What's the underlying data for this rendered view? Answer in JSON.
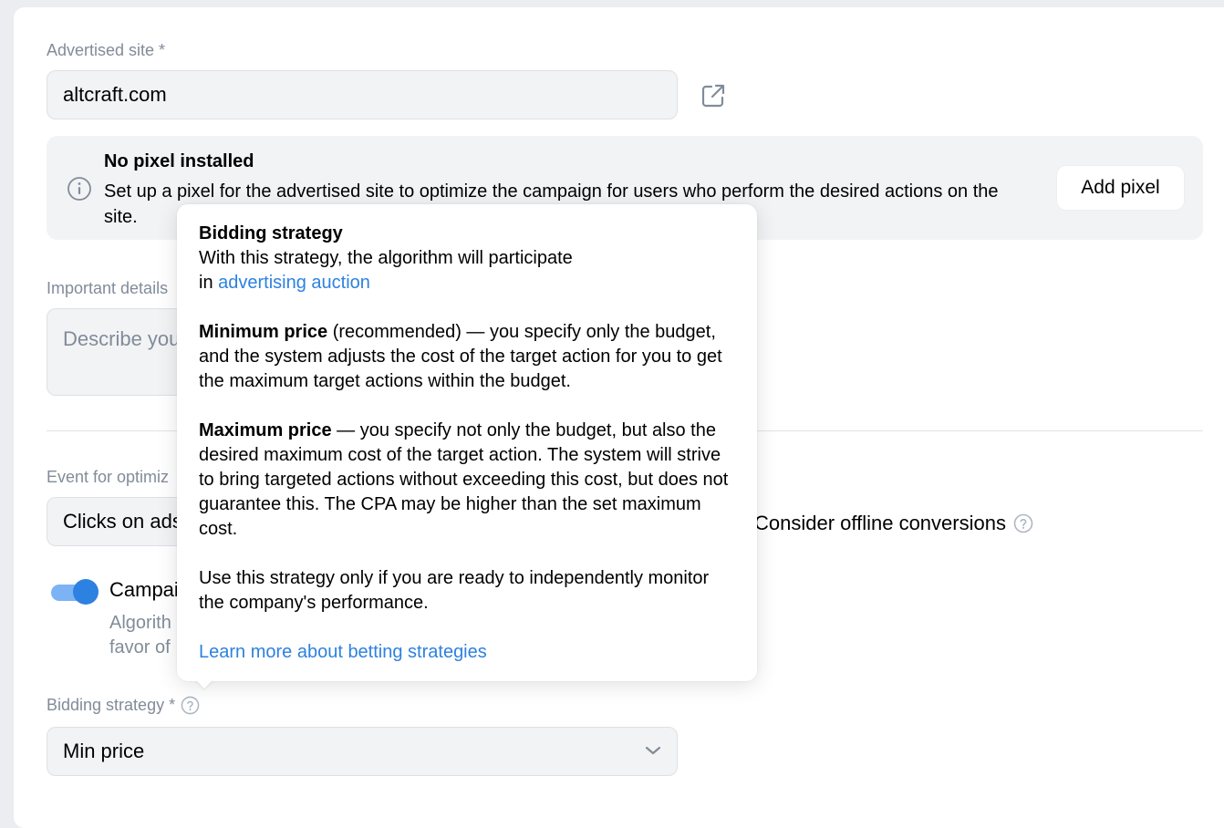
{
  "site": {
    "label": "Advertised site *",
    "value": "altcraft.com"
  },
  "pixel_notice": {
    "title": "No pixel installed",
    "text": "Set up a pixel for the advertised site to optimize the campaign for users who perform the desired actions on the site.",
    "button": "Add pixel"
  },
  "details": {
    "label": "Important details",
    "placeholder": "Describe you"
  },
  "event": {
    "label": "Event for optimiz",
    "value": "Clicks on ads",
    "offline_label": "Consider offline conversions"
  },
  "campaign": {
    "label": "Campai",
    "desc_line1": "Algorith",
    "desc_line2": "favor of",
    "toggle_on": true
  },
  "bidding": {
    "label": "Bidding strategy *",
    "value": "Min price"
  },
  "tooltip": {
    "title": "Bidding strategy",
    "intro_1": "With this strategy, the algorithm will participate",
    "intro_2_prefix": "in ",
    "intro_link": "advertising auction",
    "min_bold": "Minimum price",
    "min_text": " (recommended) — you specify only the budget, and the system adjusts the cost of the target action for you to get the maximum target actions within the budget.",
    "max_bold": "Maximum price",
    "max_text": " — you specify not only the budget, but also the desired maximum cost of the target action. The system will strive to bring targeted actions without exceeding this cost, but does not guarantee this. The CPA may be higher than the set maximum cost.",
    "use_text": "Use this strategy only if you are ready to independently monitor the company's performance.",
    "learn_link": "Learn more about betting strategies"
  },
  "colors": {
    "accent": "#2d81e0",
    "muted": "#818c99",
    "field_bg": "#f2f3f5"
  }
}
